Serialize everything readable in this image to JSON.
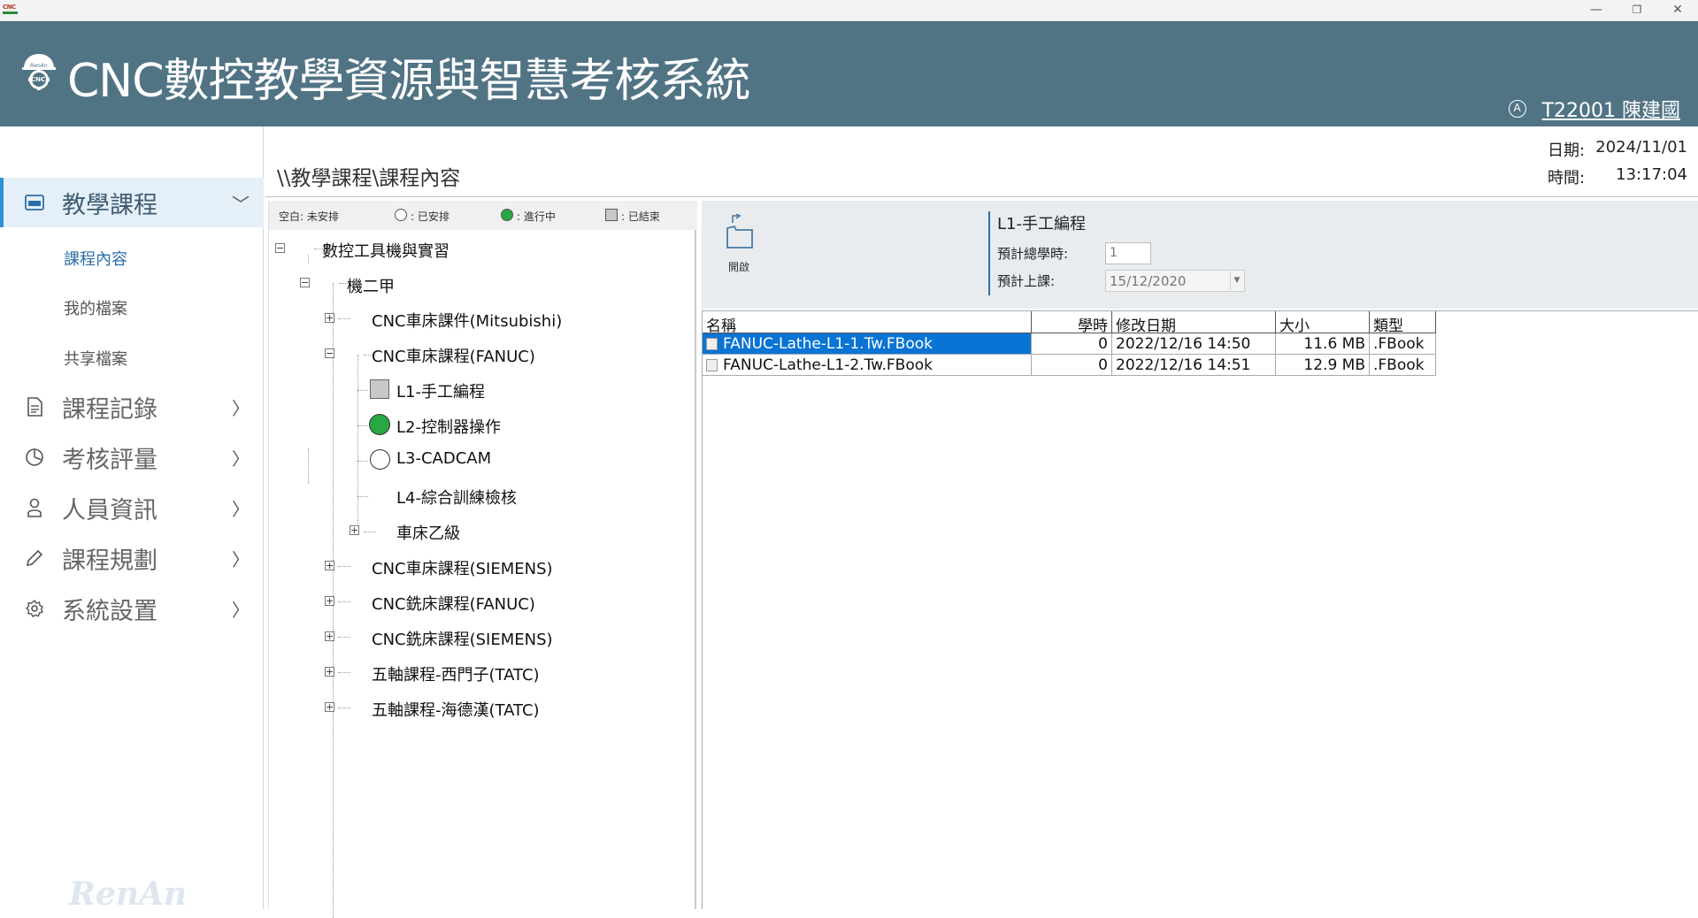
{
  "window": {
    "icon_text": "CNC",
    "minimize_glyph": "—",
    "restore_glyph": "❐",
    "close_glyph": "✕"
  },
  "header": {
    "title": "CNC數控教學資源與智慧考核系統",
    "logo_text": "CNC",
    "logo_subtext": "RenAn",
    "user_icon_glyph": "A",
    "user_name": "T22001 陳建國",
    "bg_color": "#517485"
  },
  "sidebar": {
    "watermark": "RenAn",
    "chevron_down": "﹀",
    "chevron_right": "〉",
    "items": [
      {
        "label": "教學課程",
        "icon": "book-icon",
        "active": true
      },
      {
        "label": "課程記錄",
        "icon": "document-icon"
      },
      {
        "label": "考核評量",
        "icon": "pie-chart-icon"
      },
      {
        "label": "人員資訊",
        "icon": "person-icon"
      },
      {
        "label": "課程規劃",
        "icon": "pencil-icon"
      },
      {
        "label": "系統設置",
        "icon": "gear-icon"
      }
    ],
    "subitems": [
      "課程內容",
      "我的檔案",
      "共享檔案"
    ]
  },
  "main": {
    "breadcrumb": "\\\\教學課程\\課程內容",
    "date_label": "日期:",
    "date_value": "2024/11/01",
    "time_label": "時間:",
    "time_value": "13:17:04"
  },
  "legend": {
    "unscheduled": "空白: 未安排",
    "scheduled": ": 已安排",
    "in_progress": ": 進行中",
    "finished": ": 已結束"
  },
  "tree": {
    "expand": "+",
    "collapse": "−",
    "root": "數控工具機與實習",
    "class": "機二甲",
    "nodes": [
      "CNC車床課件(Mitsubishi)",
      "CNC車床課程(FANUC)",
      "L1-手工編程",
      "L2-控制器操作",
      "L3-CADCAM",
      "L4-綜合訓練檢核",
      "車床乙級",
      "CNC車床課程(SIEMENS)",
      "CNC銑床課程(FANUC)",
      "CNC銑床課程(SIEMENS)",
      "五軸課程-西門子(TATC)",
      "五軸課程-海德漢(TATC)"
    ]
  },
  "course": {
    "open_label": "開啟",
    "title": "L1-手工編程",
    "hours_label": "預計總學時:",
    "hours_value": "1",
    "start_label": "預計上課:",
    "start_value": "15/12/2020",
    "drop_glyph": "▼"
  },
  "grid": {
    "headers": [
      "名稱",
      "學時",
      "修改日期",
      "大小",
      "類型"
    ],
    "rows": [
      [
        "FANUC-Lathe-L1-1.Tw.FBook",
        "0",
        "2022/12/16 14:50",
        "11.6 MB",
        ".FBook"
      ],
      [
        "FANUC-Lathe-L1-2.Tw.FBook",
        "0",
        "2022/12/16 14:51",
        "12.9 MB",
        ".FBook"
      ]
    ],
    "selected_color": "#0a74d4"
  }
}
